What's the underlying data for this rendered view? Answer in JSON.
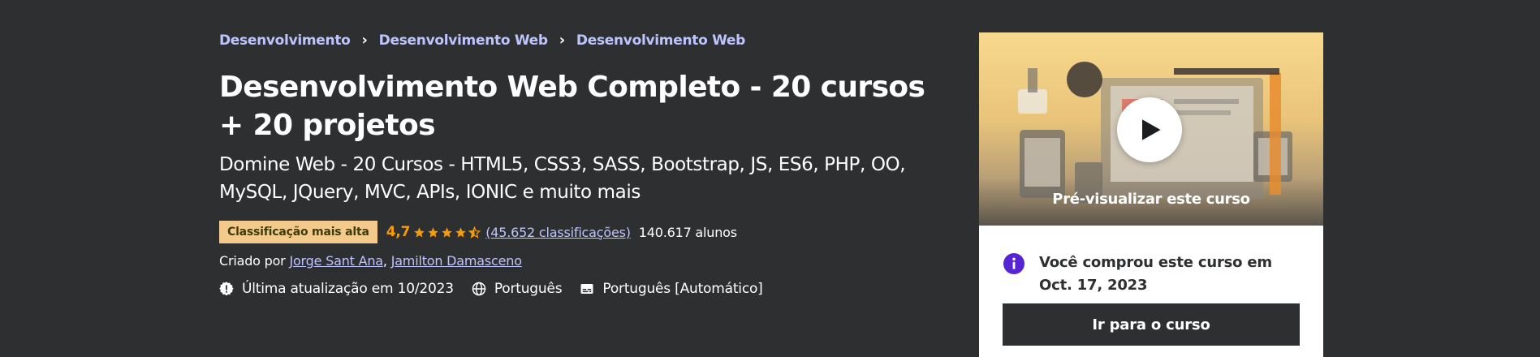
{
  "breadcrumb": [
    "Desenvolvimento",
    "Desenvolvimento Web",
    "Desenvolvimento Web"
  ],
  "course": {
    "title": "Desenvolvimento Web Completo - 20 cursos + 20 projetos",
    "subtitle": "Domine Web - 20 Cursos - HTML5, CSS3, SASS, Bootstrap, JS, ES6, PHP, OO, MySQL, JQuery, MVC, APIs, IONIC e muito mais",
    "badge": "Classificação mais alta",
    "rating": "4,7",
    "stars": 4.7,
    "ratings_count": "(45.652 classificações)",
    "students": "140.617 alunos",
    "created_by_label": "Criado por",
    "instructors": [
      "Jorge Sant Ana",
      "Jamilton Damasceno"
    ],
    "last_updated": "Última atualização em 10/2023",
    "language": "Português",
    "captions": "Português [Automático]"
  },
  "card": {
    "preview_label": "Pré-visualizar este curso",
    "purchased_text": "Você comprou este curso em Oct. 17, 2023",
    "goto_button": "Ir para o curso"
  },
  "colors": {
    "background": "#2d2f31",
    "link": "#c0c4fc",
    "badge_bg": "#f3ca8c",
    "rating": "#f69c08",
    "info_icon": "#5624d0"
  }
}
